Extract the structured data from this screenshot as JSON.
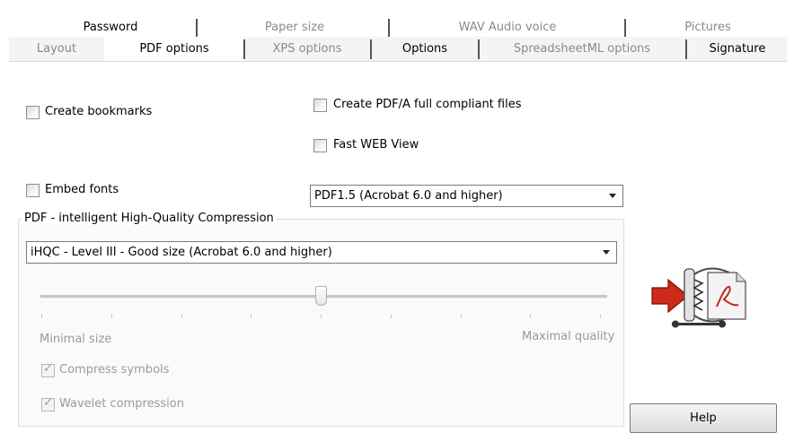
{
  "tabs": {
    "row1": [
      "Password",
      "Paper size",
      "WAV Audio voice",
      "Pictures"
    ],
    "row2": [
      "Layout",
      "PDF options",
      "XPS options",
      "Options",
      "SpreadsheetML options",
      "Signature"
    ],
    "selected": "PDF options"
  },
  "options": {
    "create_bookmarks": {
      "label": "Create bookmarks",
      "checked": false
    },
    "create_pdfa": {
      "label": "Create PDF/A full compliant files",
      "checked": false
    },
    "fast_web_view": {
      "label": "Fast WEB View",
      "checked": false
    },
    "embed_fonts": {
      "label": "Embed fonts",
      "checked": false
    },
    "pdf_version": {
      "value": "PDF1.5 (Acrobat 6.0 and higher)"
    }
  },
  "compression": {
    "group_title": "PDF - intelligent High-Quality Compression",
    "level": {
      "value": "iHQC - Level III - Good size (Acrobat 6.0 and higher)"
    },
    "slider": {
      "position": 0.5,
      "ticks": 9,
      "min_label": "Minimal size",
      "max_label": "Maximal quality"
    },
    "compress_symbols": {
      "label": "Compress symbols",
      "checked": true,
      "enabled": false
    },
    "wavelet_compression": {
      "label": "Wavelet compression",
      "checked": true,
      "enabled": false
    }
  },
  "help_button": {
    "label": "Help"
  },
  "icon": {
    "name": "pdf-compress-icon",
    "arrow_color": "#cc2a1a"
  }
}
